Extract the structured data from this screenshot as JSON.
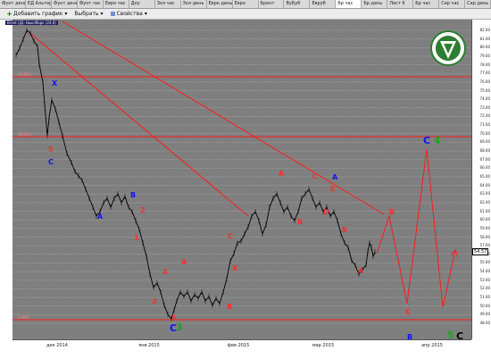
{
  "tabs": [
    "Фунт день",
    "ЕД Альтернатив",
    "Фунт день",
    "Фунт час",
    "Евро час",
    "Доу",
    "Зол час",
    "Зол день",
    "Евро день",
    "Евро",
    "Брент",
    "ВуБуб",
    "Евруб",
    "Бр час",
    "Бр день",
    "Лист 6",
    "Бр час",
    "Сер час",
    "Сер день"
  ],
  "active_tab_index": 13,
  "toolbar": {
    "add_chart": "Добавить график",
    "select": "Выбрать",
    "properties": "Свойства"
  },
  "chart_header": "Brent (Д): Нью-Йорк (24.0)",
  "fib_labels": [
    "76.40%",
    "38.20%",
    "0.00%"
  ],
  "price_ticks": [
    "82.00",
    "81.00",
    "80.00",
    "79.00",
    "78.00",
    "77.00",
    "76.00",
    "75.00",
    "74.00",
    "73.00",
    "72.00",
    "71.00",
    "70.00",
    "69.00",
    "68.00",
    "67.00",
    "66.00",
    "65.00",
    "64.00",
    "63.00",
    "62.00",
    "61.00",
    "60.00",
    "59.00",
    "58.00",
    "57.00",
    "56.00",
    "55.00",
    "54.00",
    "53.00",
    "52.00",
    "51.00",
    "50.00",
    "49.00",
    "48.00"
  ],
  "last_price": "54.57",
  "time_labels": [
    "дек 2014",
    "янв 2015",
    "фев 2015",
    "мар 2015",
    "апр 2015"
  ],
  "wave_labels": [
    {
      "t": "X",
      "c": "#1010ff"
    },
    {
      "t": "5",
      "c": "#ff2a2a"
    },
    {
      "t": "C",
      "c": "#1010ff"
    },
    {
      "t": "B",
      "c": "#1010ff"
    },
    {
      "t": "A",
      "c": "#1010ff"
    },
    {
      "t": "2",
      "c": "#ff2a2a"
    },
    {
      "t": "1",
      "c": "#ff2a2a"
    },
    {
      "t": "4",
      "c": "#ff2a2a"
    },
    {
      "t": "3",
      "c": "#ff2a2a"
    },
    {
      "t": "A",
      "c": "#ff2a2a"
    },
    {
      "t": "5",
      "c": "#ff2a2a"
    },
    {
      "t": "C",
      "c": "#1010ff"
    },
    {
      "t": "3",
      "c": "#20a020"
    },
    {
      "t": "B",
      "c": "#ff2a2a"
    },
    {
      "t": "X",
      "c": "#ff2a2a"
    },
    {
      "t": "C",
      "c": "#ff2a2a"
    },
    {
      "t": "A",
      "c": "#ff2a2a"
    },
    {
      "t": "B",
      "c": "#ff2a2a"
    },
    {
      "t": "C",
      "c": "#ff2a2a"
    },
    {
      "t": "E",
      "c": "#ff2a2a"
    },
    {
      "t": "A",
      "c": "#1010ff"
    },
    {
      "t": "D",
      "c": "#ff2a2a"
    },
    {
      "t": "B",
      "c": "#ff2a2a"
    },
    {
      "t": "A",
      "c": "#ff2a2a"
    },
    {
      "t": "B",
      "c": "#ff2a2a"
    },
    {
      "t": "C",
      "c": "#ff2a2a"
    },
    {
      "t": "B",
      "c": "#1010ff"
    },
    {
      "t": "C",
      "c": "#1010ff"
    },
    {
      "t": "4",
      "c": "#20a020"
    },
    {
      "t": "5",
      "c": "#20a020"
    },
    {
      "t": "C",
      "c": "#000000"
    }
  ],
  "colors": {
    "plot_bg": "#7f7f7f",
    "line_red": "#ff1a1a",
    "grid": "#c8c8c8",
    "price": "#000000"
  }
}
